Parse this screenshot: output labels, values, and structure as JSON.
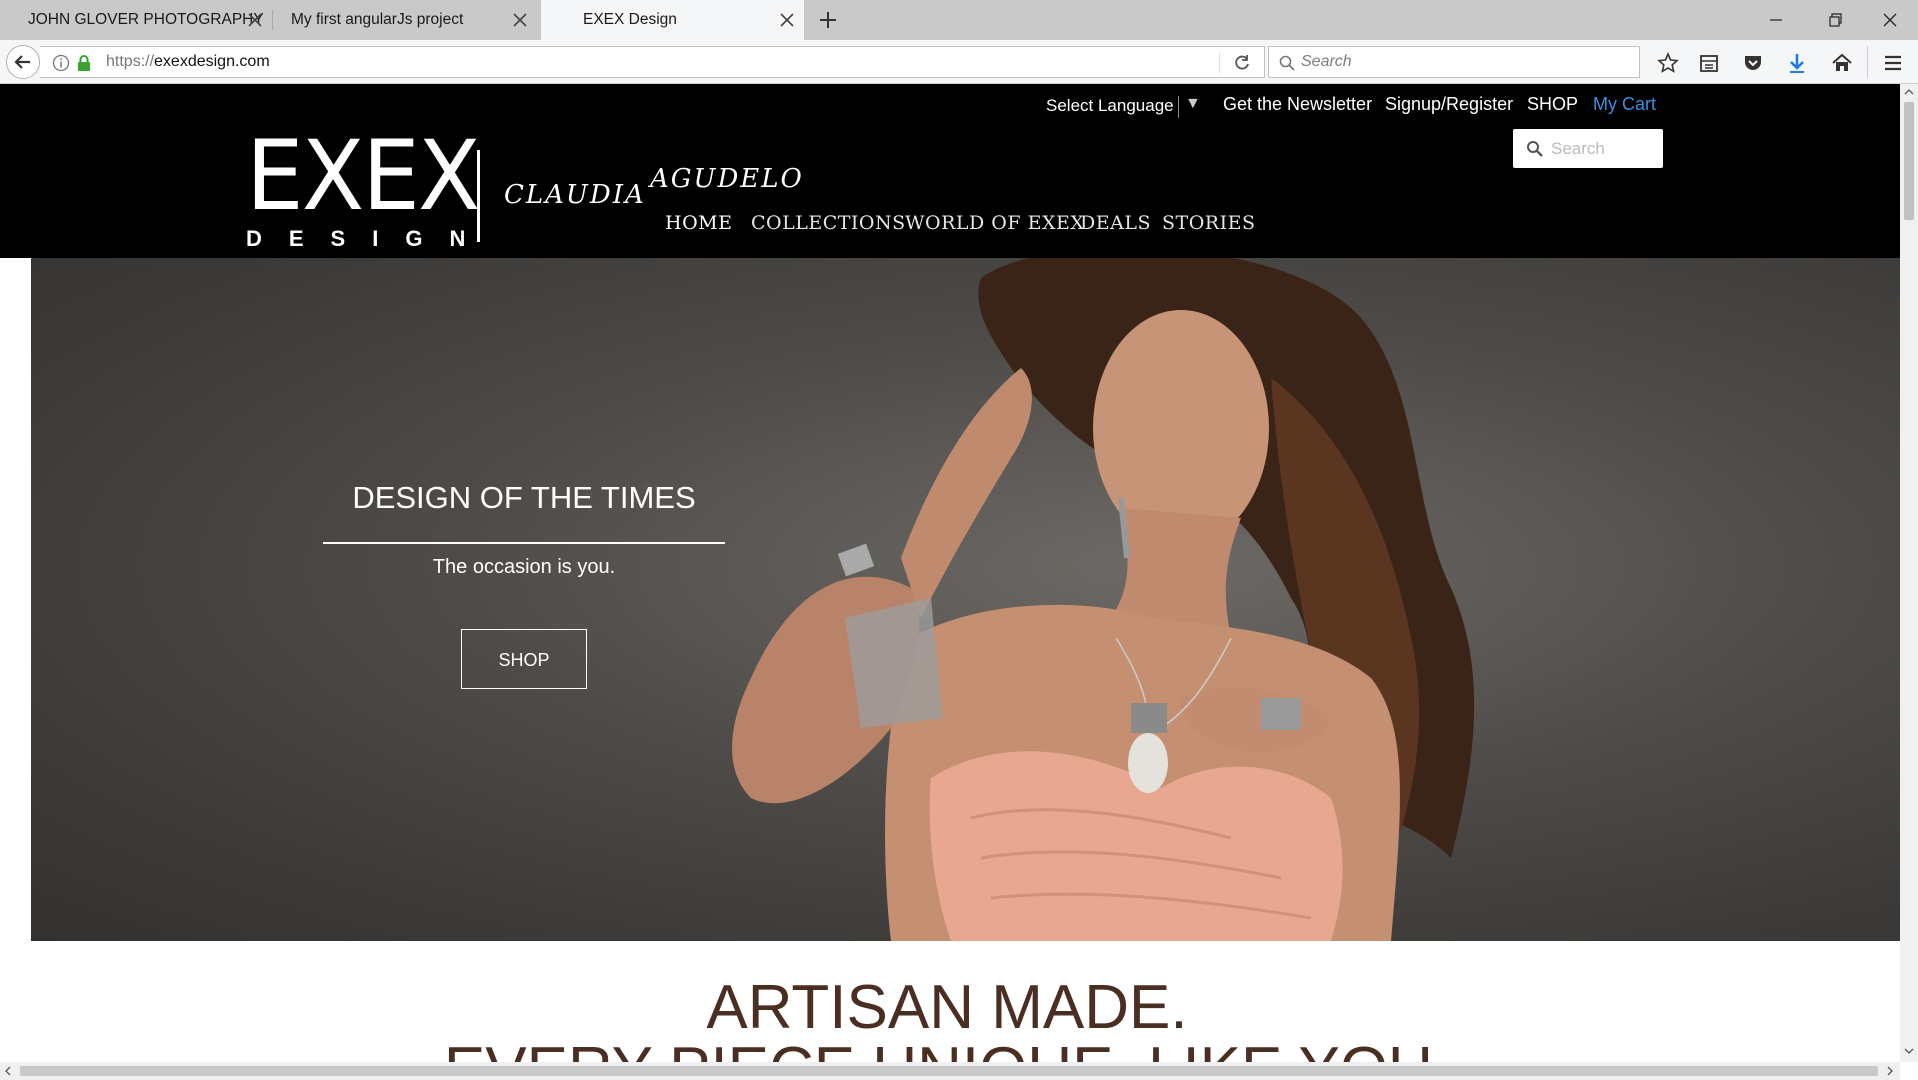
{
  "browser": {
    "tabs": [
      {
        "label": "JOHN GLOVER PHOTOGRAPHY",
        "active": false
      },
      {
        "label": "My first angularJs project",
        "active": false
      },
      {
        "label": "EXEX Design",
        "active": true
      }
    ],
    "url_prefix": "https://",
    "url_host": "exexdesign.com",
    "search_placeholder": "Search",
    "icons": [
      "back-arrow-icon",
      "info-icon",
      "lock-icon",
      "reload-icon",
      "search-icon",
      "bookmark-star-icon",
      "reading-list-icon",
      "pocket-icon",
      "download-icon",
      "home-icon",
      "menu-icon",
      "new-tab-icon",
      "minimize-icon",
      "restore-icon",
      "close-window-icon"
    ]
  },
  "site": {
    "utility": {
      "language": "Select Language",
      "language_caret": "▼",
      "newsletter": "Get the Newsletter",
      "signup": "Signup/Register",
      "shop": "SHOP",
      "cart": "My Cart"
    },
    "search_placeholder": "Search",
    "logo": {
      "brand": "EXEX",
      "sub": "DESIGN",
      "sig_first": "CLAUDIA",
      "sig_last": "AGUDELO"
    },
    "nav": [
      {
        "label": "HOME",
        "active": true
      },
      {
        "label": "COLLECTIONS",
        "active": false
      },
      {
        "label": "WORLD OF EXEX",
        "active": false
      },
      {
        "label": "DEALS",
        "active": false
      },
      {
        "label": "STORIES",
        "active": false
      }
    ],
    "hero": {
      "title": "DESIGN OF THE TIMES",
      "subtitle": "The occasion is you.",
      "cta": "SHOP"
    },
    "headline": {
      "line1": "ARTISAN MADE.",
      "line2": "EVERY PIECE UNIQUE, LIKE YOU."
    },
    "colors": {
      "header_bg": "#000000",
      "cart_link": "#3d8fe0",
      "headline": "#4a2e22",
      "hero_bg": "#4d4a47"
    }
  }
}
